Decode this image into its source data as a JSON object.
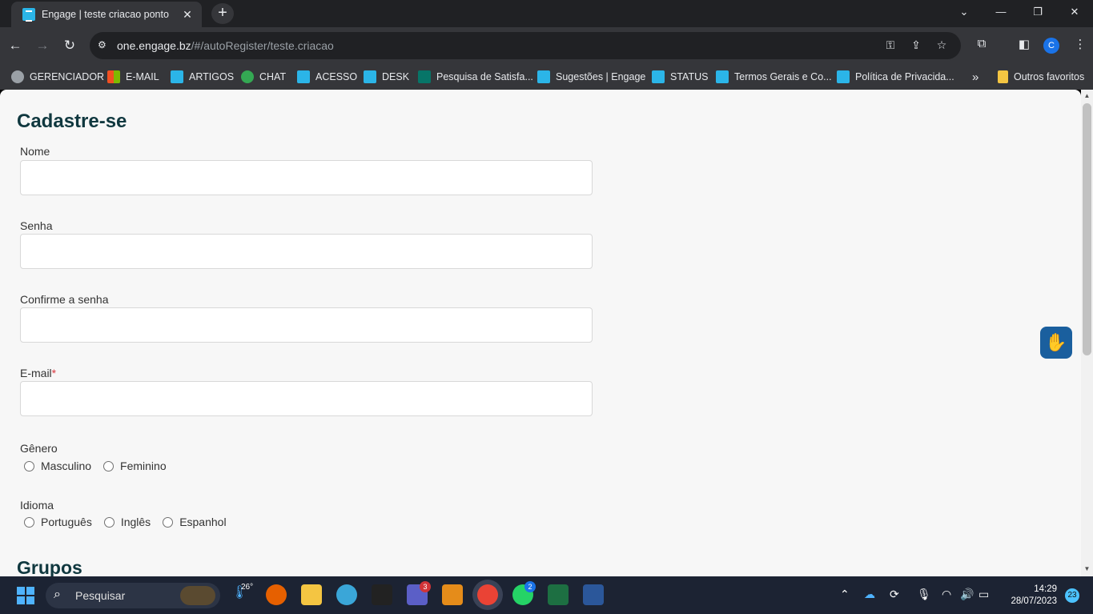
{
  "browser": {
    "tab_title": "Engage | teste criacao ponto",
    "tab_close": "✕",
    "new_tab": "+",
    "url_host": "one.engage.bz",
    "url_path": "/#/autoRegister/teste.criacao",
    "profile_initial": "C",
    "window_controls": {
      "minimize": "—",
      "maximize": "❐",
      "close": "✕"
    }
  },
  "bookmarks": [
    {
      "label": "GERENCIADOR",
      "icon": "globe-icon",
      "color": "#9aa0a6"
    },
    {
      "label": "E-MAIL",
      "icon": "microsoft-icon",
      "color": "#f25022"
    },
    {
      "label": "ARTIGOS",
      "icon": "engage-icon",
      "color": "#2bb5e8"
    },
    {
      "label": "CHAT",
      "icon": "chat-icon",
      "color": "#34a853"
    },
    {
      "label": "ACESSO",
      "icon": "engage-icon",
      "color": "#2bb5e8"
    },
    {
      "label": "DESK",
      "icon": "engage-icon",
      "color": "#2bb5e8"
    },
    {
      "label": "Pesquisa de Satisfa...",
      "icon": "forms-icon",
      "color": "#077568"
    },
    {
      "label": "Sugestões | Engage",
      "icon": "engage-icon",
      "color": "#2bb5e8"
    },
    {
      "label": "STATUS",
      "icon": "engage-icon",
      "color": "#2bb5e8"
    },
    {
      "label": "Termos Gerais e Co...",
      "icon": "engage-icon",
      "color": "#2bb5e8"
    },
    {
      "label": "Política de Privacida...",
      "icon": "engage-icon",
      "color": "#2bb5e8"
    }
  ],
  "bookmarks_more": "»",
  "other_bookmarks": "Outros favoritos",
  "form": {
    "title": "Cadastre-se",
    "name_label": "Nome",
    "password_label": "Senha",
    "confirm_label": "Confirme a senha",
    "email_label": "E-mail",
    "email_required": "*",
    "gender_label": "Gênero",
    "gender_options": [
      "Masculino",
      "Feminino"
    ],
    "language_label": "Idioma",
    "language_options": [
      "Português",
      "Inglês",
      "Espanhol"
    ],
    "groups_title": "Grupos"
  },
  "taskbar": {
    "search_placeholder": "Pesquisar",
    "weather_temp": "26°",
    "teams_badge": "3",
    "whatsapp_badge": "2",
    "time": "14:29",
    "date": "28/07/2023",
    "notifications": "23"
  },
  "colors": {
    "accent": "#10383f",
    "required": "#d9363e",
    "vlibras": "#1a5f9e"
  }
}
